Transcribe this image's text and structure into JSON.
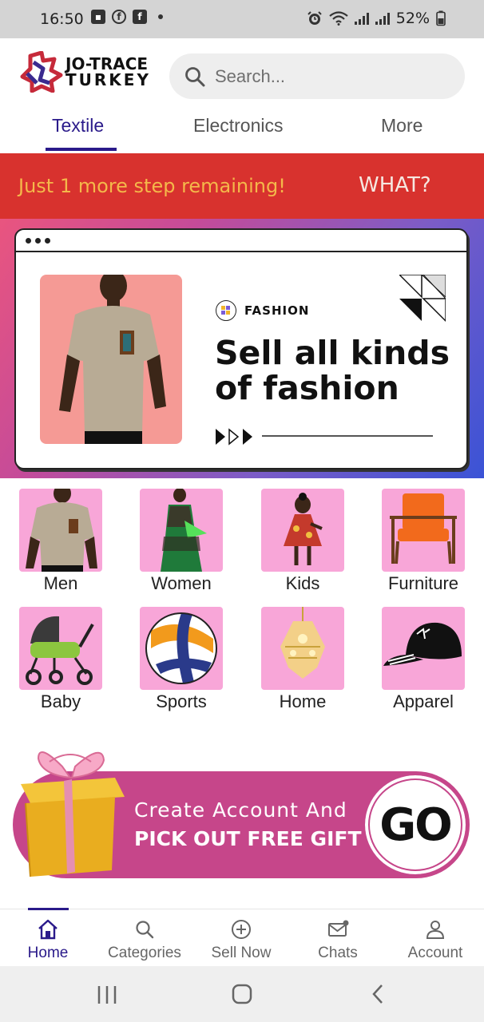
{
  "status_bar": {
    "time": "16:50",
    "battery": "52%"
  },
  "header": {
    "logo_line1": "JO-TRACE",
    "logo_line2": "TURKEY",
    "search_placeholder": "Search..."
  },
  "tabs": [
    {
      "label": "Textile",
      "active": true
    },
    {
      "label": "Electronics",
      "active": false
    },
    {
      "label": "More",
      "active": false
    }
  ],
  "promo": {
    "text": "Just 1 more step remaining!",
    "action": "WHAT?"
  },
  "hero": {
    "tag": "FASHION",
    "title": "Sell all kinds of fashion"
  },
  "categories": [
    {
      "label": "Men",
      "icon": "tshirt-man-icon"
    },
    {
      "label": "Women",
      "icon": "dress-woman-icon"
    },
    {
      "label": "Kids",
      "icon": "kid-dress-icon"
    },
    {
      "label": "Furniture",
      "icon": "armchair-icon"
    },
    {
      "label": "Baby",
      "icon": "stroller-icon"
    },
    {
      "label": "Sports",
      "icon": "volleyball-icon"
    },
    {
      "label": "Home",
      "icon": "chandelier-icon"
    },
    {
      "label": "Apparel",
      "icon": "cap-icon"
    }
  ],
  "gift_banner": {
    "line1": "Create Account And",
    "line2": "PICK OUT FREE GIFT",
    "button": "GO"
  },
  "bottom_nav": [
    {
      "label": "Home",
      "icon": "home-icon",
      "active": true
    },
    {
      "label": "Categories",
      "icon": "search-icon",
      "active": false
    },
    {
      "label": "Sell Now",
      "icon": "plus-circle-icon",
      "active": false
    },
    {
      "label": "Chats",
      "icon": "mail-icon",
      "active": false
    },
    {
      "label": "Account",
      "icon": "person-icon",
      "active": false
    }
  ],
  "colors": {
    "accent": "#2a1a8a",
    "promo_bg": "#d8322e",
    "promo_text": "#f4b84a",
    "category_bg": "#f8a6d8",
    "gift_bg": "#c6468a"
  }
}
